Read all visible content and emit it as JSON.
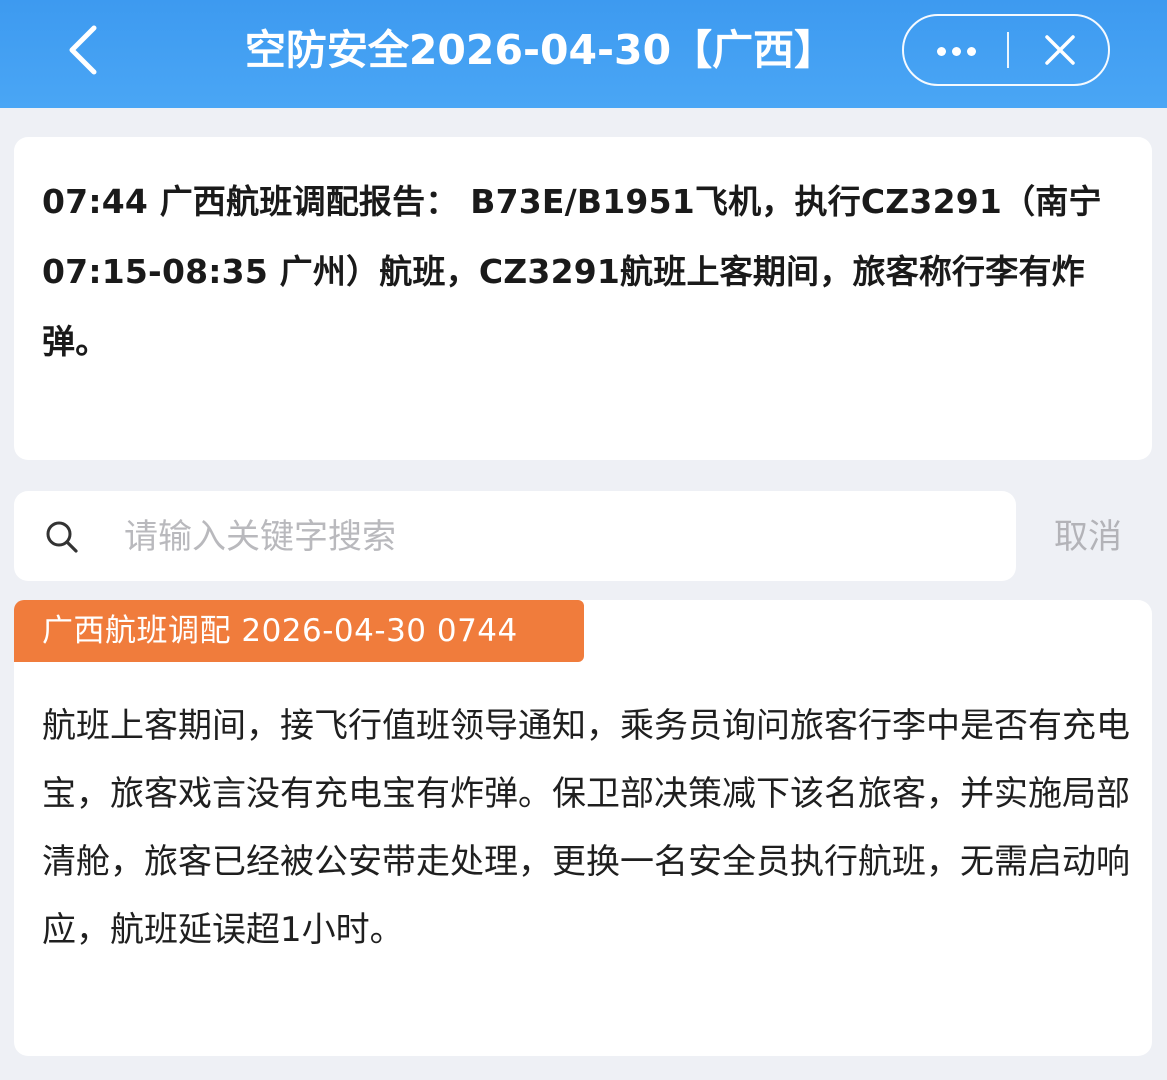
{
  "header": {
    "title": "空防安全2026-04-30【广西】",
    "back_icon": "chevron-left-icon",
    "more_icon": "more-dots-icon",
    "close_icon": "close-icon",
    "background": "#4aa6f5"
  },
  "report": {
    "text": "07:44 广西航班调配报告： B73E/B1951飞机，执行CZ3291（南宁 07:15-08:35 广州）航班，CZ3291航班上客期间，旅客称行李有炸弹。"
  },
  "search": {
    "placeholder": "请输入关键字搜索",
    "value": "",
    "icon": "search-icon",
    "cancel_label": "取消"
  },
  "detail": {
    "tag": "广西航班调配 2026-04-30 0744",
    "tag_color": "#f07c3c",
    "body": "航班上客期间，接飞行值班领导通知，乘务员询问旅客行李中是否有充电宝，旅客戏言没有充电宝有炸弹。保卫部决策减下该名旅客，并实施局部清舱，旅客已经被公安带走处理，更换一名安全员执行航班，无需启动响应，航班延误超1小时。"
  }
}
